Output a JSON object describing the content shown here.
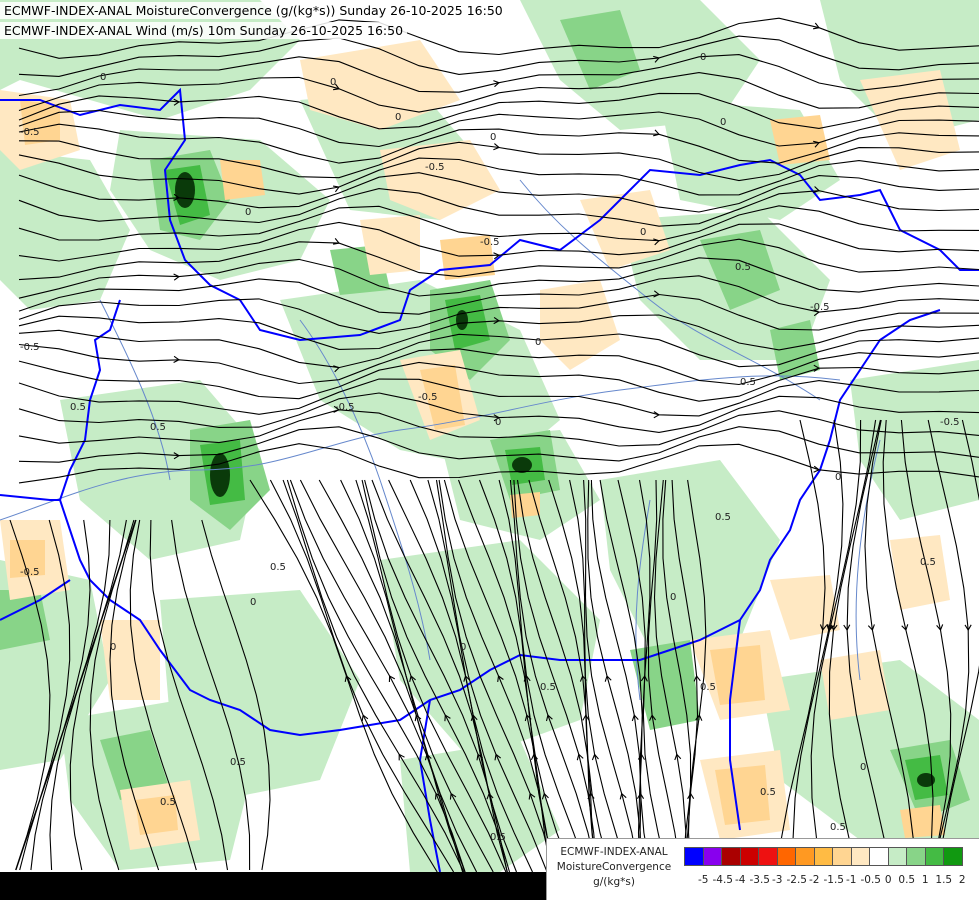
{
  "header": {
    "line1": "ECMWF-INDEX-ANAL MoistureConvergence (g/(kg*s)) Sunday 26-10-2025 16:50",
    "line2": "ECMWF-INDEX-ANAL Wind (m/s) 10m Sunday 26-10-2025 16:50"
  },
  "legend": {
    "title_lines": [
      "ECMWF-INDEX-ANAL",
      "MoistureConvergence",
      "g/(kg*s)"
    ],
    "ticks": [
      "-5",
      "-4.5",
      "-4",
      "-3.5",
      "-3",
      "-2.5",
      "-2",
      "-1.5",
      "-1",
      "-0.5",
      "0",
      "0.5",
      "1",
      "1.5",
      "2"
    ],
    "colors": [
      "#0000ff",
      "#8800ee",
      "#aa0000",
      "#cc0000",
      "#ee1111",
      "#ff6600",
      "#ff9922",
      "#ffbb44",
      "#ffd592",
      "#ffe8c2",
      "#ffffff",
      "#c6ecc6",
      "#88d488",
      "#44bb44",
      "#119911"
    ]
  },
  "map": {
    "contour_labels": [
      "0",
      "-0.5",
      "0.5"
    ],
    "colors": {
      "convergence_light": "#c6ecc6",
      "convergence_mid": "#88d488",
      "convergence_strong": "#44bb44",
      "convergence_peak": "#0a3a0a",
      "divergence_light": "#ffe8c2",
      "divergence_mid": "#ffd592",
      "divergence_strong": "#ffbb44",
      "border": "#0000ff",
      "river": "#6688cc",
      "streamline": "#000000"
    }
  }
}
